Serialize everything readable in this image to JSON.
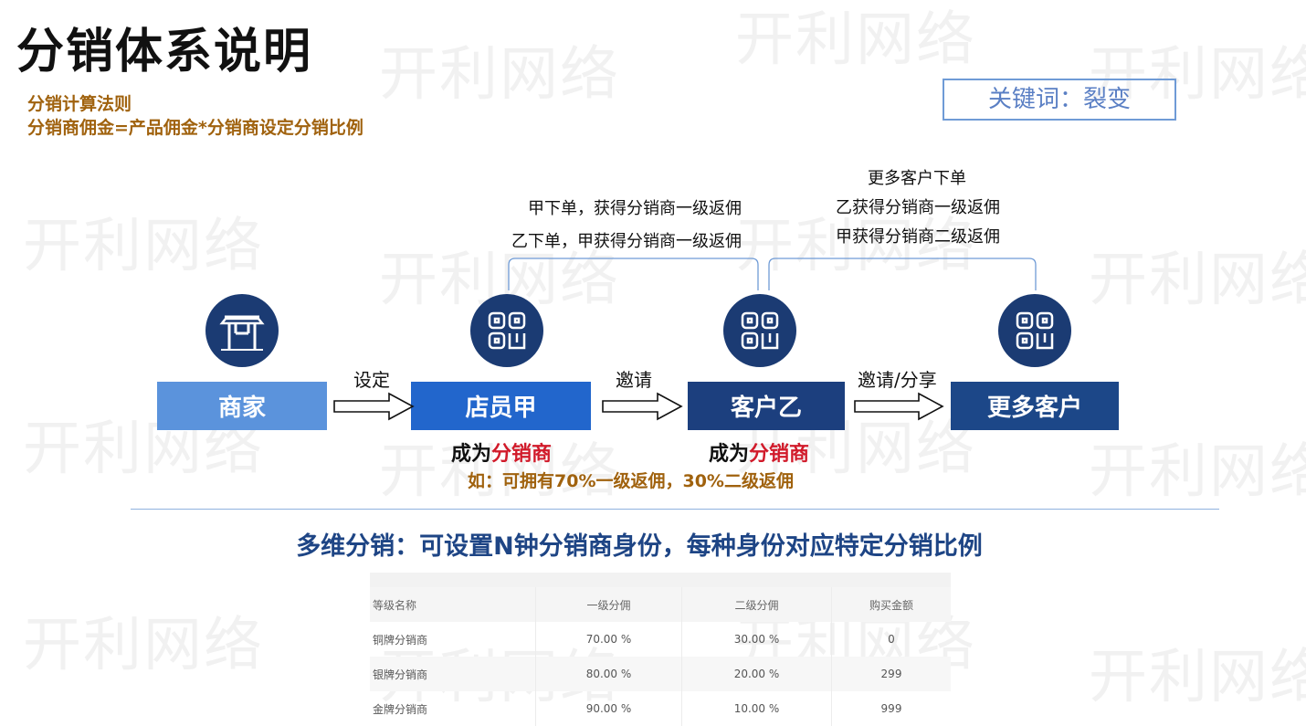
{
  "watermark": "开利网络",
  "title": "分销体系说明",
  "formula": {
    "line1": "分销计算法则",
    "line2": "分销商佣金=产品佣金*分销商设定分销比例"
  },
  "keyword": "关键词：裂变",
  "notes_left": {
    "line1": "甲下单，获得分销商一级返佣",
    "line2": "乙下单，甲获得分销商一级返佣"
  },
  "notes_right": {
    "line1": "更多客户下单",
    "line2": "乙获得分销商一级返佣",
    "line3": "甲获得分销商二级返佣"
  },
  "flow": {
    "boxes": [
      {
        "label": "商家",
        "color": "#5b93dc",
        "icon": "shop-gate-icon"
      },
      {
        "label": "店员甲",
        "color": "#2266cc",
        "icon": "qr-code-icon"
      },
      {
        "label": "客户乙",
        "color": "#1c3f7e",
        "icon": "qr-code-icon"
      },
      {
        "label": "更多客户",
        "color": "#1c4788",
        "icon": "qr-code-icon"
      }
    ],
    "arrows": [
      "设定",
      "邀请",
      "邀请/分享"
    ],
    "become_prefix": "成为",
    "become_role": "分销商",
    "example": "如：可拥有70%一级返佣，30%二级返佣"
  },
  "subtitle": "多维分销：可设置N钟分销商身份，每种身份对应特定分销比例",
  "table": {
    "headers": [
      "等级名称",
      "一级分佣",
      "二级分佣",
      "购买金额"
    ],
    "rows": [
      [
        "铜牌分销商",
        "70.00 %",
        "30.00 %",
        "0"
      ],
      [
        "银牌分销商",
        "80.00 %",
        "20.00 %",
        "299"
      ],
      [
        "金牌分销商",
        "90.00 %",
        "10.00 %",
        "999"
      ]
    ]
  }
}
